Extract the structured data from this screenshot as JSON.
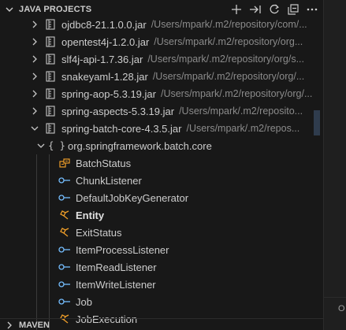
{
  "panel": {
    "title": "JAVA PROJECTS",
    "actions": [
      "plus-icon",
      "arrow-right-to-bar-icon",
      "refresh-icon",
      "collapse-all-icon",
      "more-icon"
    ]
  },
  "jars": [
    {
      "label": "ojdbc8-21.1.0.0.jar",
      "path": "/Users/mpark/.m2/repository/com/..."
    },
    {
      "label": "opentest4j-1.2.0.jar",
      "path": "/Users/mpark/.m2/repository/org..."
    },
    {
      "label": "slf4j-api-1.7.36.jar",
      "path": "/Users/mpark/.m2/repository/org/s..."
    },
    {
      "label": "snakeyaml-1.28.jar",
      "path": "/Users/mpark/.m2/repository/org/..."
    },
    {
      "label": "spring-aop-5.3.19.jar",
      "path": "/Users/mpark/.m2/repository/org/..."
    },
    {
      "label": "spring-aspects-5.3.19.jar",
      "path": "/Users/mpark/.m2/reposito..."
    },
    {
      "label": "spring-batch-core-4.3.5.jar",
      "path": "/Users/mpark/.m2/repos..."
    }
  ],
  "package": {
    "label": "org.springframework.batch.core"
  },
  "classes": [
    {
      "label": "BatchStatus",
      "kind": "enum-icon"
    },
    {
      "label": "ChunkListener",
      "kind": "interface-icon"
    },
    {
      "label": "DefaultJobKeyGenerator",
      "kind": "class-icon"
    },
    {
      "label": "Entity",
      "kind": "class-icon"
    },
    {
      "label": "ExitStatus",
      "kind": "enum-icon"
    },
    {
      "label": "ItemProcessListener",
      "kind": "interface-icon"
    },
    {
      "label": "ItemReadListener",
      "kind": "interface-icon"
    },
    {
      "label": "ItemWriteListener",
      "kind": "interface-icon"
    },
    {
      "label": "Job",
      "kind": "interface-icon"
    },
    {
      "label": "JobExecution",
      "kind": "class-icon"
    }
  ],
  "footer": {
    "title": "MAVEN"
  },
  "right_pane": {
    "text": "O"
  },
  "colors": {
    "enum": "#ee9d28",
    "interface": "#75beff",
    "class": "#ee9d28",
    "background": "#181818"
  }
}
